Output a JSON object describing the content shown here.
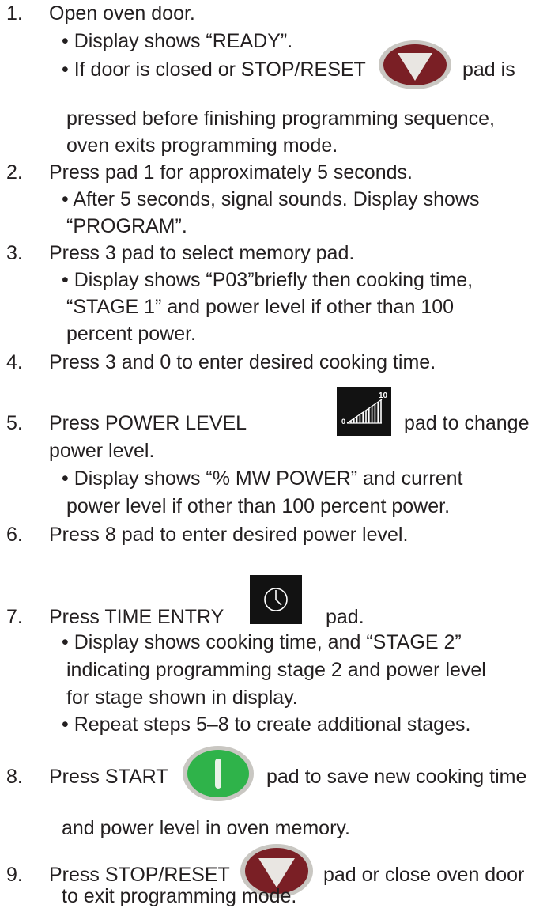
{
  "steps": {
    "s1": {
      "num": "1.",
      "text": "Open oven door.",
      "b1": "• Display shows “READY”.",
      "b2_pre": "• If door is closed or STOP/RESET",
      "b2_post": "pad is",
      "b2_cont1": "pressed before finishing programming sequence,",
      "b2_cont2": "oven exits programming mode."
    },
    "s2": {
      "num": "2.",
      "text": "Press pad 1 for approximately 5 seconds.",
      "b1": "• After 5 seconds, signal sounds. Display shows",
      "b1_cont": "“PROGRAM”."
    },
    "s3": {
      "num": "3.",
      "text": "Press 3 pad to select memory pad.",
      "b1": "• Display shows “P03”briefly then cooking time,",
      "b1_cont1": "“STAGE 1” and power level if other than 100",
      "b1_cont2": "percent power."
    },
    "s4": {
      "num": "4.",
      "text": "Press 3 and 0 to enter desired cooking time."
    },
    "s5": {
      "num": "5.",
      "text_pre": "Press POWER LEVEL",
      "text_post": "pad to change",
      "text_cont": "power level.",
      "b1": "• Display shows “% MW POWER” and current",
      "b1_cont": "power level if other than 100 percent power."
    },
    "s6": {
      "num": "6.",
      "text": "Press 8 pad to enter desired power level."
    },
    "s7": {
      "num": "7.",
      "text_pre": "Press TIME ENTRY",
      "text_post": "pad.",
      "b1": "• Display shows cooking time, and “STAGE 2”",
      "b1_cont1": "indicating programming stage 2 and power level",
      "b1_cont2": "for stage shown in display.",
      "b2": "• Repeat steps 5–8 to create additional stages."
    },
    "s8": {
      "num": "8.",
      "text_pre": "Press START",
      "text_post": "pad to save new cooking time",
      "text_cont": "and power level in oven memory."
    },
    "s9": {
      "num": "9.",
      "text_pre": "Press STOP/RESET",
      "text_post": "pad or close oven door",
      "text_cont": "to exit programming mode."
    }
  },
  "icons": {
    "power_level_min": "0",
    "power_level_max": "10",
    "stop_color": "#7a1f25",
    "start_color": "#2fb34a",
    "dark_pad_color": "#121212",
    "icon_ring_color": "#c9c7c2"
  }
}
